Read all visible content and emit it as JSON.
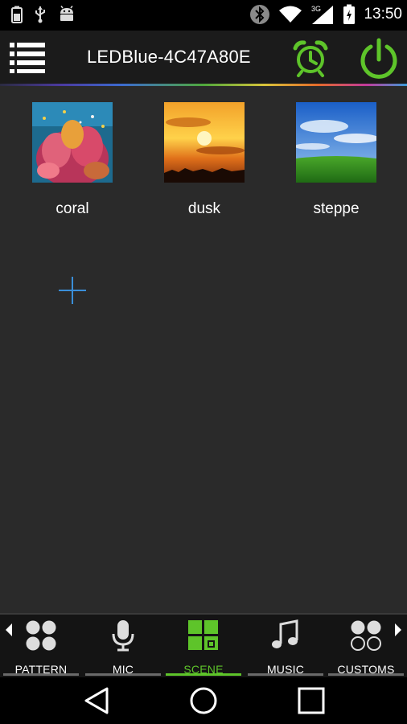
{
  "status_bar": {
    "time": "13:50",
    "network_type": "3G",
    "left_icons": [
      "battery-saver-icon",
      "usb-icon",
      "android-debug-icon"
    ],
    "right_icons": [
      "bluetooth-icon",
      "wifi-icon",
      "cell-signal-icon",
      "battery-charging-icon"
    ]
  },
  "header": {
    "title": "LEDBlue-4C47A80E",
    "accent_color": "#5ec42a"
  },
  "scenes": [
    {
      "label": "coral",
      "icon": "coral-reef-image"
    },
    {
      "label": "dusk",
      "icon": "sunset-image"
    },
    {
      "label": "steppe",
      "icon": "grassland-sky-image"
    }
  ],
  "add_scene_icon": "plus-icon",
  "bottom_nav": {
    "active": "SCENE",
    "items": [
      {
        "label": "PATTERN",
        "icon": "pattern-icon"
      },
      {
        "label": "MIC",
        "icon": "microphone-icon"
      },
      {
        "label": "SCENE",
        "icon": "scene-icon"
      },
      {
        "label": "MUSIC",
        "icon": "music-note-icon"
      },
      {
        "label": "CUSTOMS",
        "icon": "customs-icon"
      }
    ]
  },
  "system_nav": [
    "back-icon",
    "home-icon",
    "recents-icon"
  ]
}
